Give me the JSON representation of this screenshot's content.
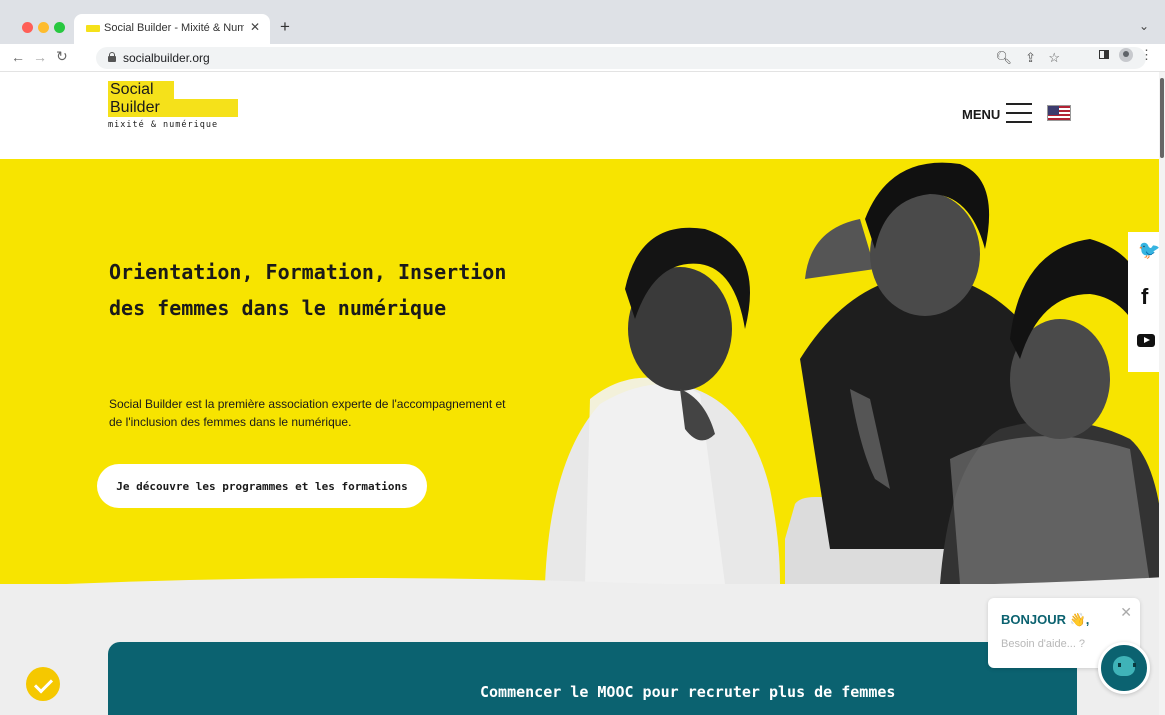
{
  "browser": {
    "tab_title": "Social Builder - Mixité & Numérique",
    "tab_close": "✕",
    "new_tab": "+",
    "url": "socialbuilder.org"
  },
  "header": {
    "logo_line1": "Social",
    "logo_line2": "Builder",
    "logo_tagline": "mixité & numérique",
    "menu_label": "MENU"
  },
  "hero": {
    "title": "Orientation, Formation, Insertion des femmes dans le numérique",
    "description": "Social Builder est la première association experte de l'accompagnement et de l'inclusion des femmes dans le numérique.",
    "cta_label": "Je découvre les programmes et les formations"
  },
  "social": {
    "twitter_glyph": "🐦",
    "facebook_glyph": "f"
  },
  "mooc": {
    "title": "Commencer le MOOC pour recruter plus de femmes"
  },
  "chat": {
    "greeting": "BONJOUR 👋,",
    "subtitle": "Besoin d'aide... ?",
    "close": "✕"
  },
  "colors": {
    "brand_yellow": "#f7e400",
    "brand_teal": "#0b6270",
    "text_dark": "#1a1a1a"
  }
}
